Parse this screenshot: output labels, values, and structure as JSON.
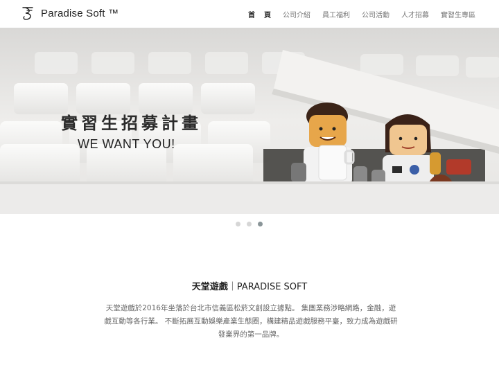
{
  "header": {
    "brand": "Paradise Soft ™",
    "nav": [
      {
        "label": "首頁",
        "active": true
      },
      {
        "label": "公司介紹"
      },
      {
        "label": "員工福利"
      },
      {
        "label": "公司活動"
      },
      {
        "label": "人才招募"
      },
      {
        "label": "實習生專區"
      }
    ]
  },
  "hero": {
    "title": "實習生招募計畫",
    "subtitle": "WE WANT YOU!",
    "slides": 3,
    "active_slide": 3
  },
  "about": {
    "title_zh": "天堂遊戲",
    "title_sep": "｜",
    "title_en": "PARADISE SOFT",
    "body": "天堂遊戲於2016年坐落於台北市信義區松菸文創設立據點。 集團業務涉略網路，金融，遊戲互動等各行業。 不斷拓展互動娛樂產業生態圈，構建精品遊戲服務平臺，致力成為遊戲研發業界的第一品牌。"
  },
  "colors": {
    "dot_active": "#8a9598",
    "dot_inactive": "#d6d6d6",
    "nav_text": "#777777"
  }
}
